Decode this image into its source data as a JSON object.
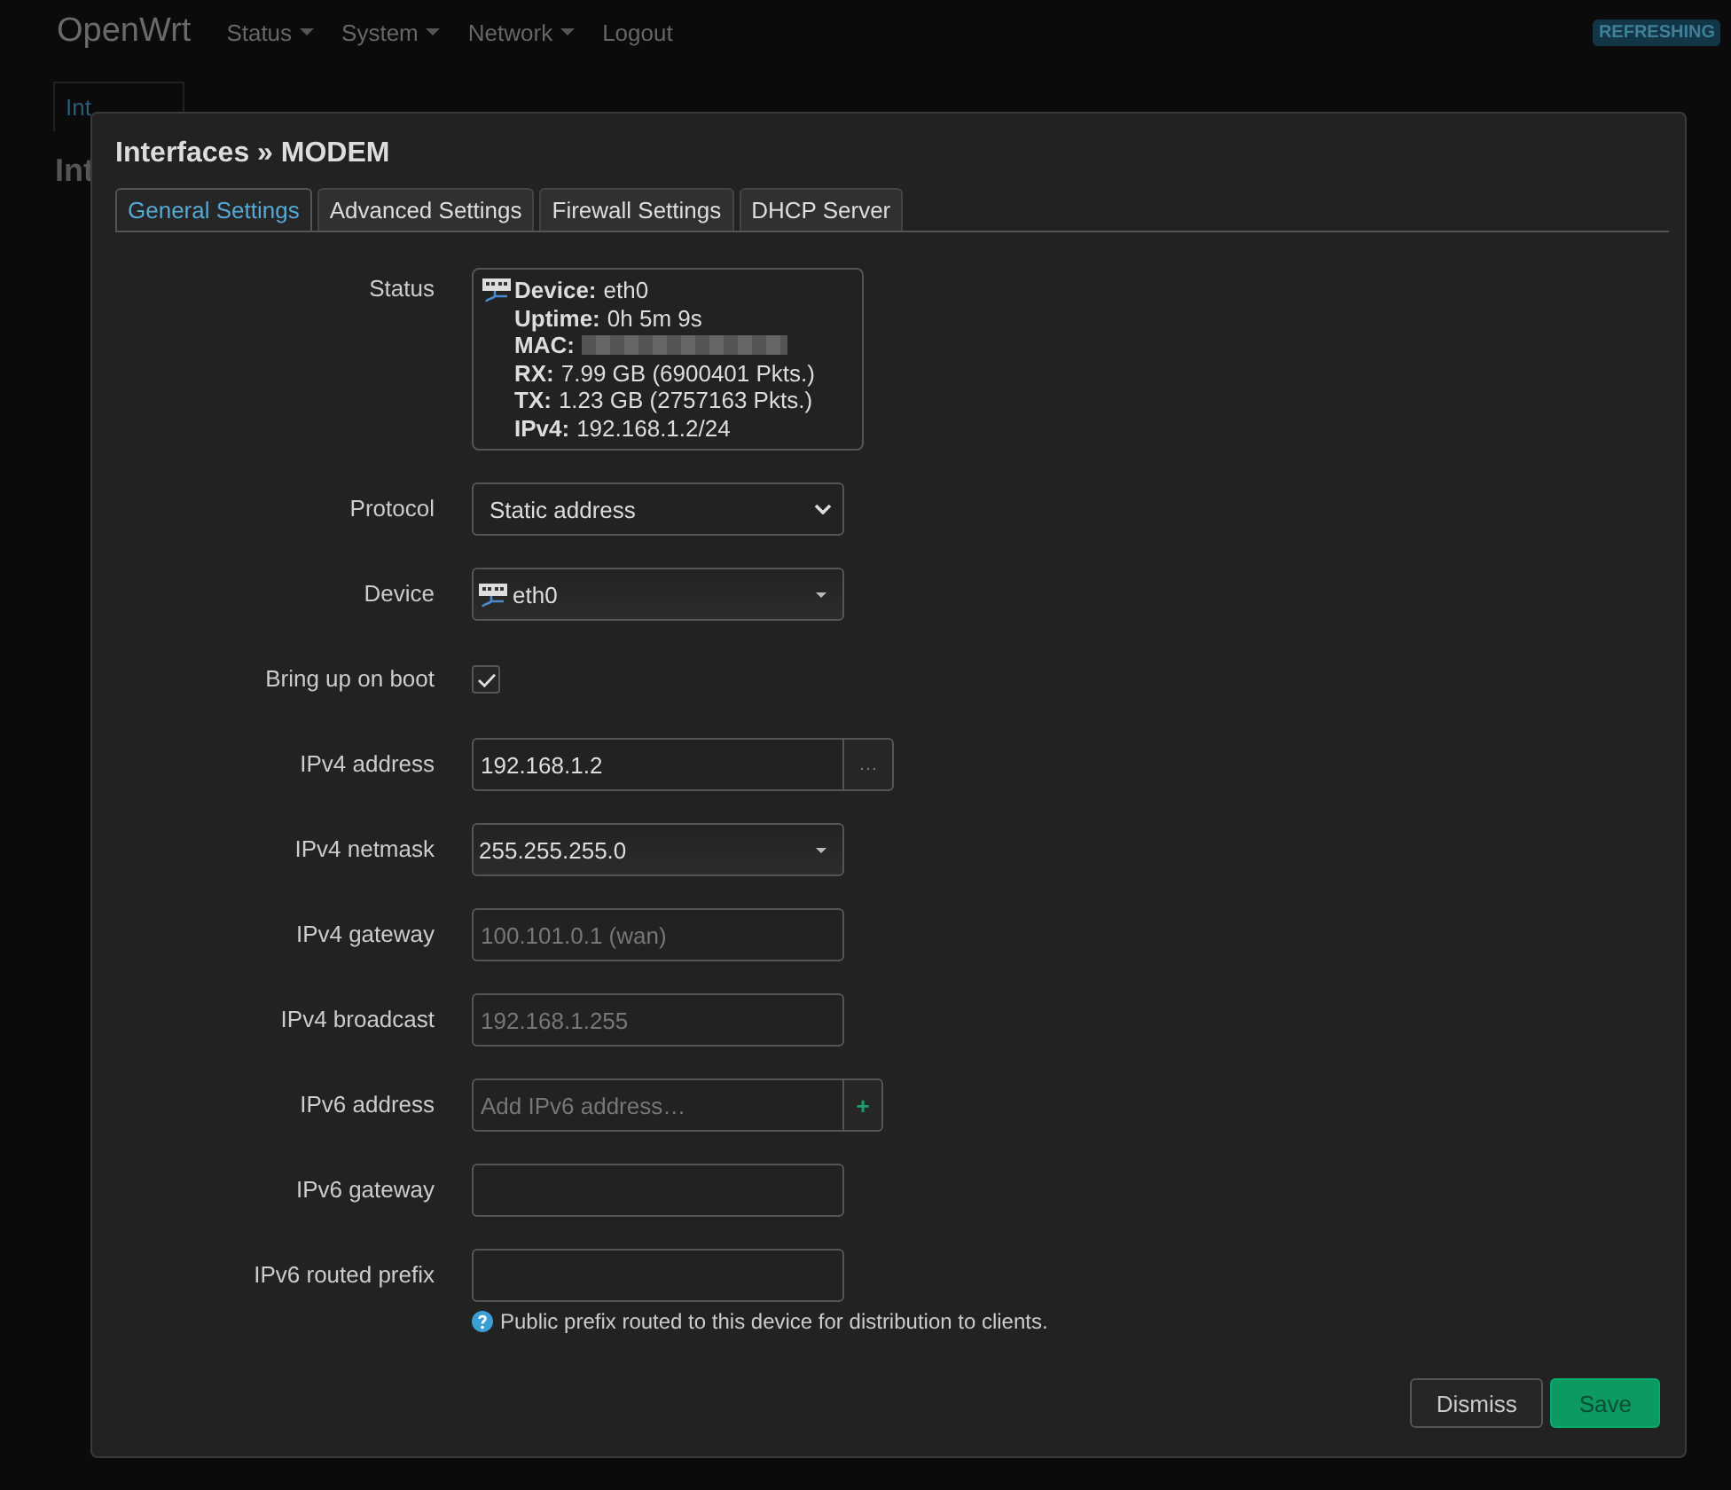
{
  "header": {
    "brand": "OpenWrt",
    "menu": [
      {
        "label": "Status",
        "dropdown": true
      },
      {
        "label": "System",
        "dropdown": true
      },
      {
        "label": "Network",
        "dropdown": true
      },
      {
        "label": "Logout",
        "dropdown": false
      }
    ],
    "badge": "REFRESHING"
  },
  "background": {
    "tab": "Int",
    "heading": "Int"
  },
  "dialog": {
    "title": "Interfaces » MODEM",
    "tabs": [
      {
        "label": "General Settings",
        "selected": true
      },
      {
        "label": "Advanced Settings",
        "selected": false
      },
      {
        "label": "Firewall Settings",
        "selected": false
      },
      {
        "label": "DHCP Server",
        "selected": false
      }
    ],
    "fields": [
      {
        "kind": "status",
        "label": "Status",
        "lines": [
          {
            "label": "Device:",
            "value": "eth0",
            "redacted": false
          },
          {
            "label": "Uptime:",
            "value": "0h 5m 9s",
            "redacted": false
          },
          {
            "label": "MAC:",
            "redacted": true
          },
          {
            "label": "RX:",
            "value": "7.99 GB (6900401 Pkts.)",
            "redacted": false
          },
          {
            "label": "TX:",
            "value": "1.23 GB (2757163 Pkts.)",
            "redacted": false
          },
          {
            "label": "IPv4:",
            "value": "192.168.1.2/24",
            "redacted": false
          }
        ]
      },
      {
        "kind": "select",
        "label": "Protocol",
        "value": "Static address"
      },
      {
        "kind": "device",
        "label": "Device",
        "value": "eth0"
      },
      {
        "kind": "checkbox",
        "label": "Bring up on boot",
        "checked": true
      },
      {
        "kind": "text",
        "label": "IPv4 address",
        "value": "192.168.1.2",
        "button": "…"
      },
      {
        "kind": "dropdown",
        "label": "IPv4 netmask",
        "value": "255.255.255.0"
      },
      {
        "kind": "text",
        "label": "IPv4 gateway",
        "placeholder": "100.101.0.1 (wan)"
      },
      {
        "kind": "text",
        "label": "IPv4 broadcast",
        "placeholder": "192.168.1.255"
      },
      {
        "kind": "text",
        "label": "IPv6 address",
        "placeholder": "Add IPv6 address…",
        "button": "+"
      },
      {
        "kind": "text",
        "label": "IPv6 gateway"
      },
      {
        "kind": "text",
        "label": "IPv6 routed prefix",
        "help": "Public prefix routed to this device for distribution to clients."
      }
    ],
    "buttons": [
      {
        "label": "Dismiss",
        "kind": "secondary"
      },
      {
        "label": "Save",
        "kind": "primary"
      }
    ]
  }
}
